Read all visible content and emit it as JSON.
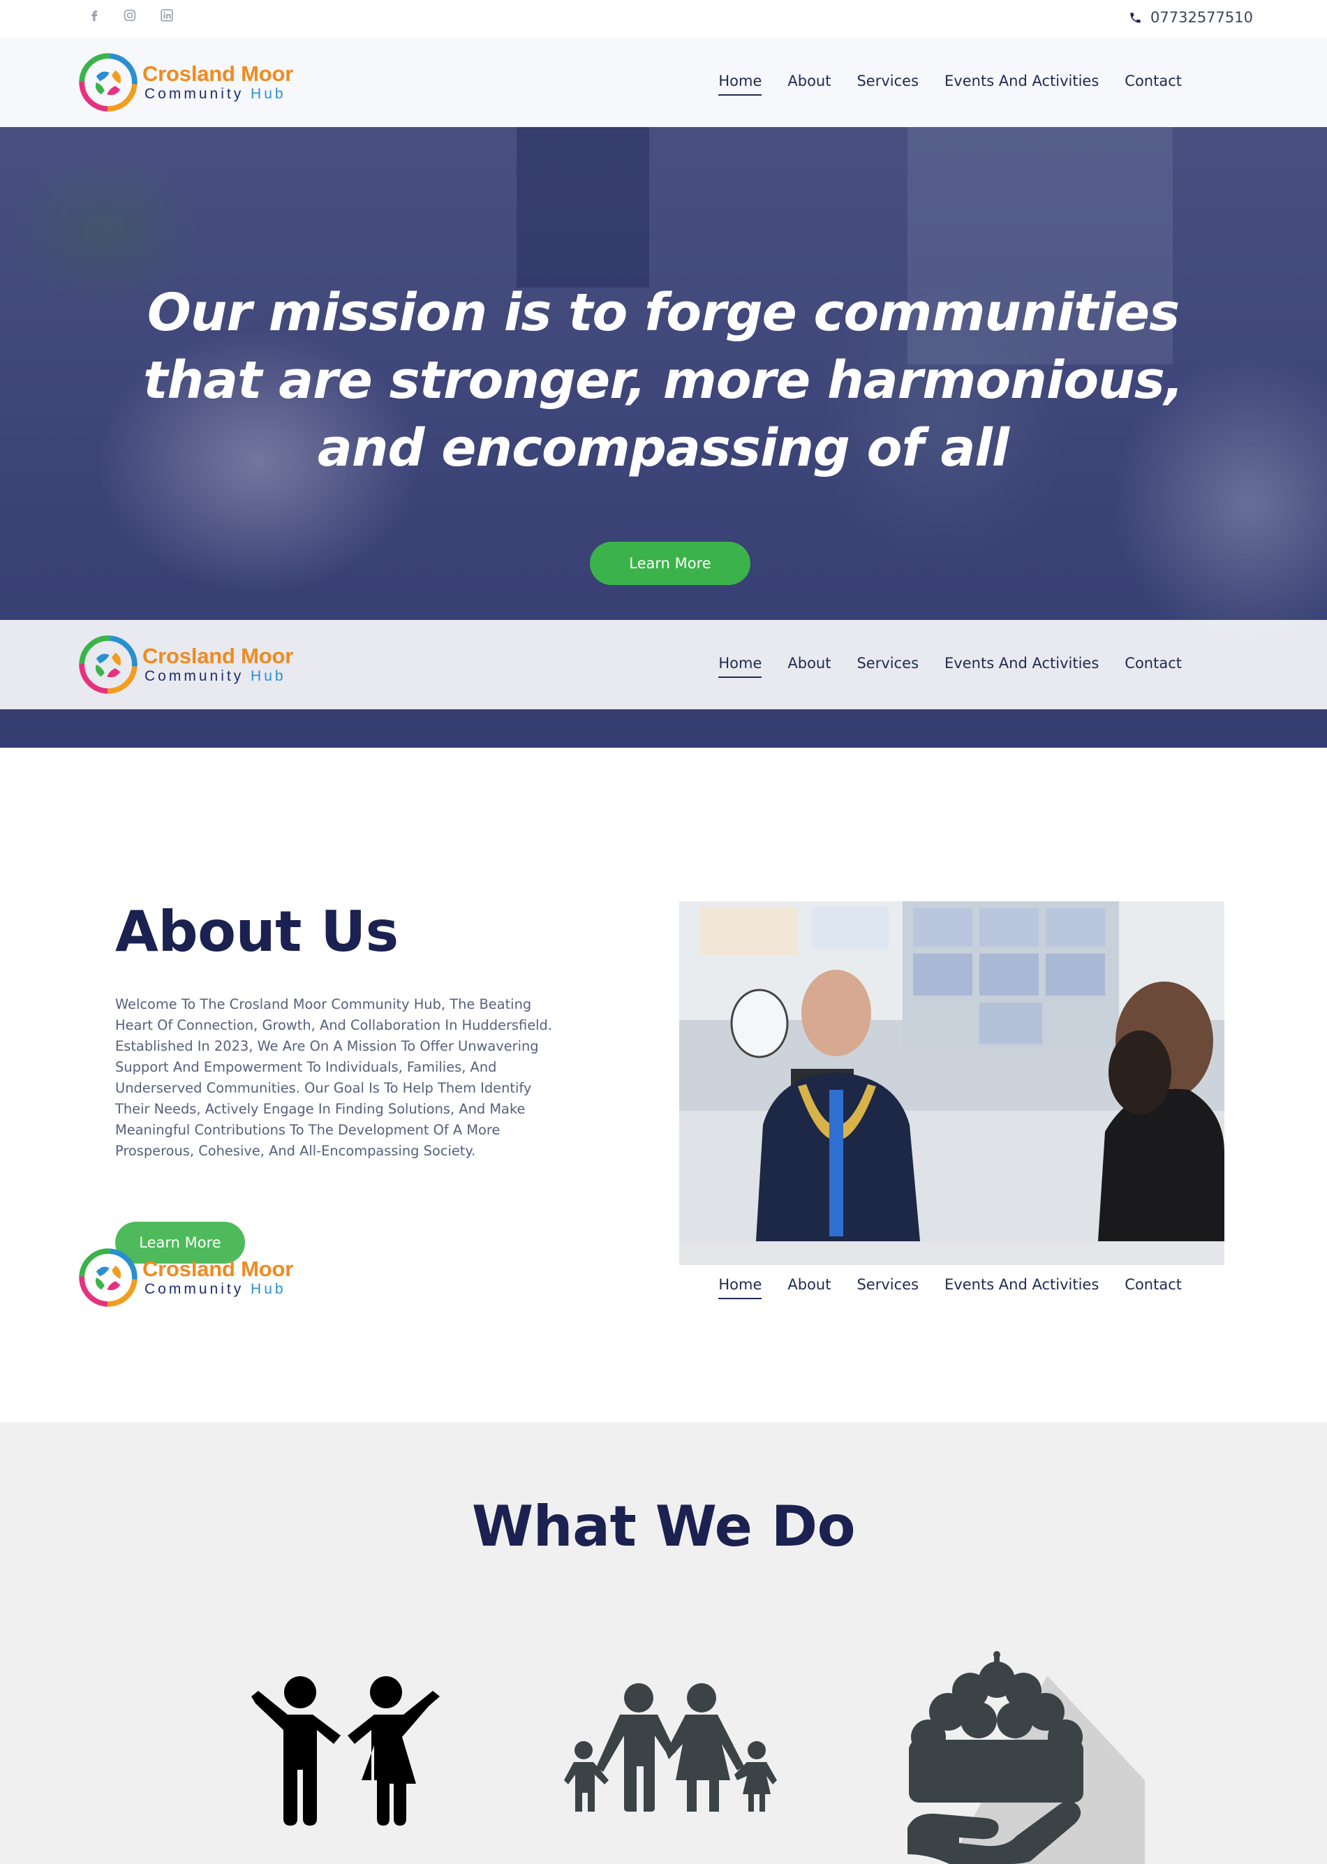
{
  "topbar": {
    "social": [
      "facebook-icon",
      "instagram-icon",
      "linkedin-icon"
    ],
    "phone": "07732577510"
  },
  "brand": {
    "name": "Crosland Moor",
    "sub_left": "Community",
    "sub_right": "Hub",
    "colors": {
      "orange": "#ef8a1f",
      "navy": "#1d2d6b",
      "blue": "#2b8fcf"
    }
  },
  "nav": {
    "items": [
      {
        "label": "Home",
        "active": true
      },
      {
        "label": "About"
      },
      {
        "label": "Services"
      },
      {
        "label": "Events And Activities"
      },
      {
        "label": "Contact"
      }
    ]
  },
  "hero": {
    "title": "Our mission is to forge communities that are stronger, more harmonious, and encompassing of all",
    "button": "Learn More"
  },
  "about": {
    "title": "About Us",
    "text": "Welcome To The Crosland Moor Community Hub, The Beating Heart Of Connection, Growth, And Collaboration In Huddersfield. Established In 2023, We Are On A Mission To Offer Unwavering Support And Empowerment To Individuals, Families, And Underserved Communities. Our Goal Is To Help Them Identify Their Needs, Actively Engage In Finding Solutions, And Make Meaningful Contributions To The Development Of A More Prosperous, Cohesive, And All-Encompassing Society.",
    "button": "Learn More"
  },
  "what_we_do": {
    "title": "What We Do",
    "icons": [
      "children-icon",
      "family-icon",
      "community-care-icon"
    ]
  },
  "colors": {
    "accent_green": "#3bb34a",
    "heading_navy": "#1b2150",
    "hero_overlay": "#3d4478"
  }
}
